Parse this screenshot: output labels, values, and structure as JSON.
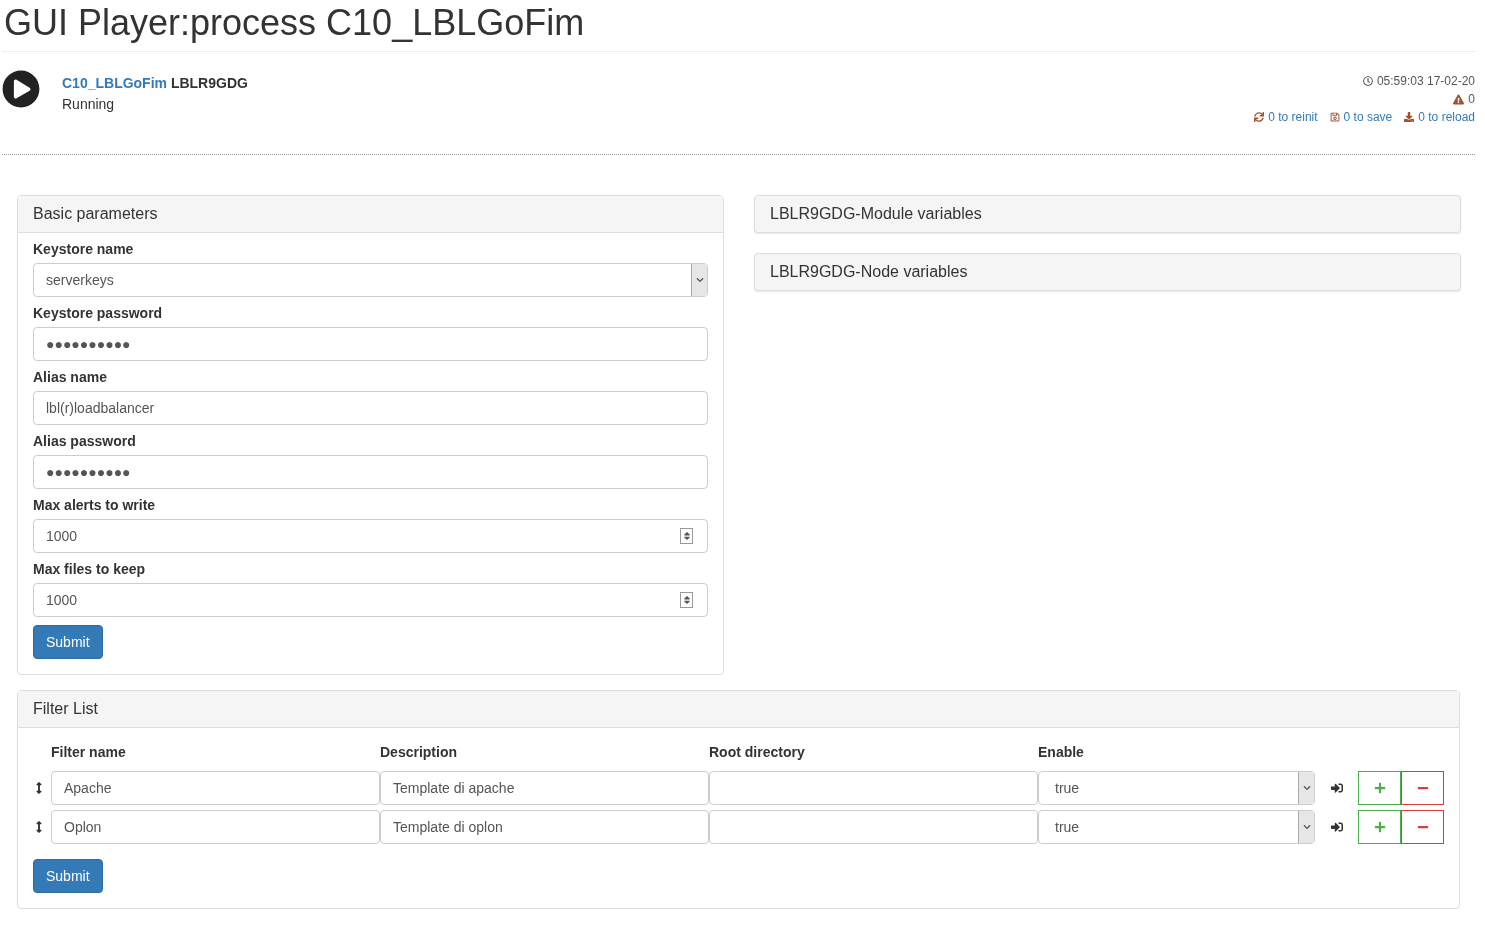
{
  "title": "GUI Player:process C10_LBLGoFim",
  "process": {
    "name": "C10_LBLGoFim",
    "node": "LBLR9GDG",
    "status": "Running"
  },
  "header_info": {
    "time": "05:59:03 17-02-20",
    "alerts": "0",
    "actions": [
      {
        "kind": "reinit",
        "label": "0 to reinit"
      },
      {
        "kind": "save",
        "label": "0 to save"
      },
      {
        "kind": "reload",
        "label": "0 to reload"
      }
    ]
  },
  "basic_parameters": {
    "title": "Basic parameters",
    "fields": [
      {
        "label": "Keystore name",
        "kind": "select",
        "value": "serverkeys"
      },
      {
        "label": "Keystore password",
        "kind": "password",
        "value": "●●●●●●●●●●"
      },
      {
        "label": "Alias name",
        "kind": "text",
        "value": "lbl(r)loadbalancer"
      },
      {
        "label": "Alias password",
        "kind": "password",
        "value": "●●●●●●●●●●"
      },
      {
        "label": "Max alerts to write",
        "kind": "number",
        "value": "1000"
      },
      {
        "label": "Max files to keep",
        "kind": "number",
        "value": "1000"
      }
    ],
    "submit": "Submit"
  },
  "side_panels": [
    {
      "title": "LBLR9GDG-Module variables"
    },
    {
      "title": "LBLR9GDG-Node variables"
    }
  ],
  "filter_list": {
    "title": "Filter List",
    "columns": [
      "Filter name",
      "Description",
      "Root directory",
      "Enable"
    ],
    "rows": [
      {
        "filter_name": "Apache",
        "description": "Template di apache",
        "root_directory": "",
        "enable": "true"
      },
      {
        "filter_name": "Oplon",
        "description": "Template di oplon",
        "root_directory": "",
        "enable": "true"
      }
    ],
    "submit": "Submit"
  }
}
